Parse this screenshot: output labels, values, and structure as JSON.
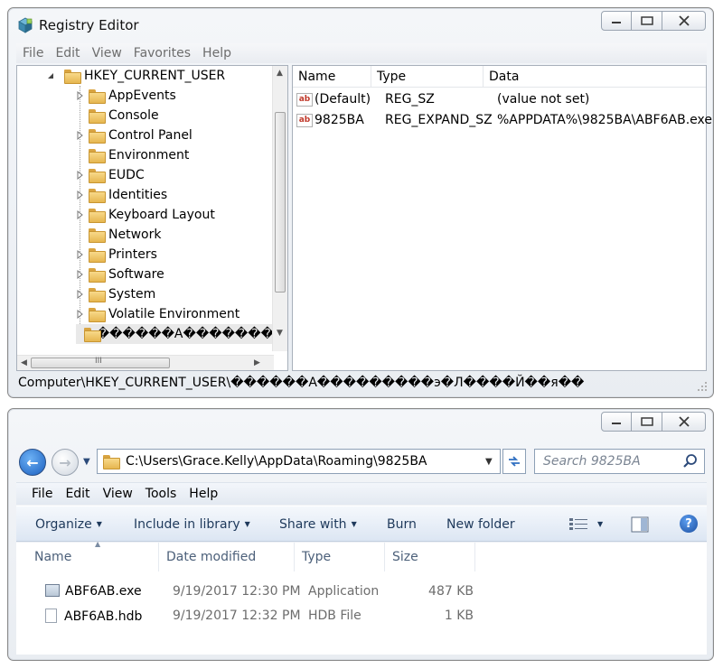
{
  "registry": {
    "title": "Registry Editor",
    "menu": [
      "File",
      "Edit",
      "View",
      "Favorites",
      "Help"
    ],
    "tree": {
      "root": "HKEY_CURRENT_USER",
      "children": [
        "AppEvents",
        "Console",
        "Control Panel",
        "Environment",
        "EUDC",
        "Identities",
        "Keyboard Layout",
        "Network",
        "Printers",
        "Software",
        "System",
        "Volatile Environment",
        "������А�������"
      ]
    },
    "columns": [
      "Name",
      "Type",
      "Data"
    ],
    "values": [
      {
        "name": "(Default)",
        "type": "REG_SZ",
        "data": "(value not set)"
      },
      {
        "name": "9825BA",
        "type": "REG_EXPAND_SZ",
        "data": "%APPDATA%\\9825BA\\ABF6AB.exe"
      }
    ],
    "status": "Computer\\HKEY_CURRENT_USER\\������А���������э�Л����Й��я��",
    "scroll_glyph": "III"
  },
  "explorer": {
    "address": "C:\\Users\\Grace.Kelly\\AppData\\Roaming\\9825BA",
    "search_placeholder": "Search 9825BA",
    "menu": [
      "File",
      "Edit",
      "View",
      "Tools",
      "Help"
    ],
    "commands": {
      "organize": "Organize",
      "include": "Include in library",
      "share": "Share with",
      "burn": "Burn",
      "new_folder": "New folder"
    },
    "columns": [
      "Name",
      "Date modified",
      "Type",
      "Size"
    ],
    "files": [
      {
        "name": "ABF6AB.exe",
        "date": "9/19/2017 12:30 PM",
        "type": "Application",
        "size": "487 KB"
      },
      {
        "name": "ABF6AB.hdb",
        "date": "9/19/2017 12:32 PM",
        "type": "HDB File",
        "size": "1 KB"
      }
    ]
  },
  "icons": {
    "regedit": "regedit-cube-icon",
    "folder": "folder-icon",
    "string_value": "ab-string-value-icon",
    "back": "back-arrow-icon",
    "forward": "forward-arrow-icon",
    "refresh": "refresh-icon",
    "search": "search-icon",
    "help": "help-icon",
    "views": "views-icon",
    "preview": "preview-pane-icon"
  }
}
